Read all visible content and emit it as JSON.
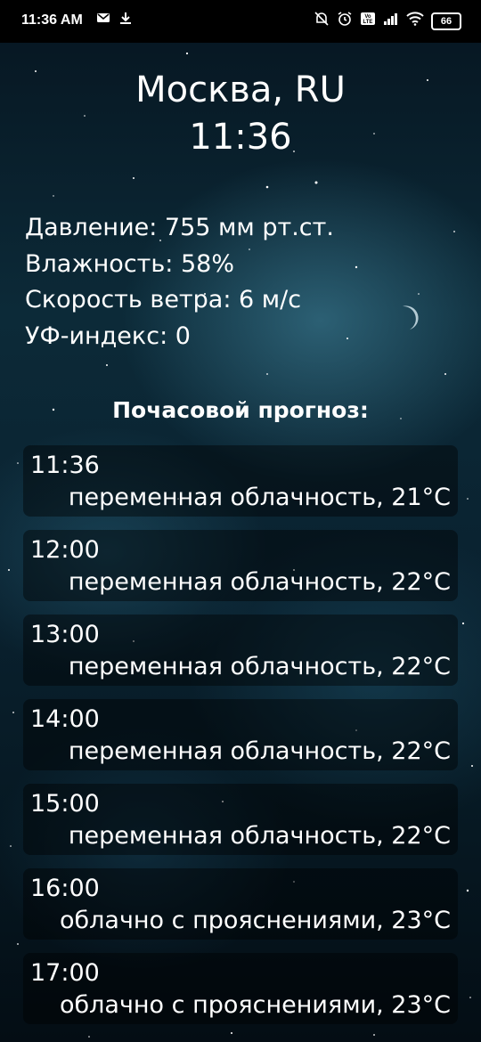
{
  "status_bar": {
    "time": "11:36 AM",
    "battery": "66",
    "icons_left": [
      "mail-icon",
      "download-icon"
    ],
    "icons_right": [
      "mute-icon",
      "alarm-icon",
      "volte-icon",
      "signal-icon",
      "wifi-icon",
      "battery-icon"
    ]
  },
  "header": {
    "city": "Москва, RU",
    "time": "11:36"
  },
  "weather": {
    "pressure": "Давление: 755 мм рт.ст.",
    "humidity": "Влажность: 58%",
    "wind": "Скорость ветра: 6 м/с",
    "uv": "УФ-индекс: 0"
  },
  "forecast": {
    "title": "Почасовой прогноз:",
    "items": [
      {
        "time": "11:36",
        "desc": "переменная облачность, 21°C"
      },
      {
        "time": "12:00",
        "desc": "переменная облачность, 22°C"
      },
      {
        "time": "13:00",
        "desc": "переменная облачность, 22°C"
      },
      {
        "time": "14:00",
        "desc": "переменная облачность, 22°C"
      },
      {
        "time": "15:00",
        "desc": "переменная облачность, 22°C"
      },
      {
        "time": "16:00",
        "desc": "облачно с прояснениями, 23°C"
      },
      {
        "time": "17:00",
        "desc": "облачно с прояснениями, 23°C"
      }
    ]
  }
}
